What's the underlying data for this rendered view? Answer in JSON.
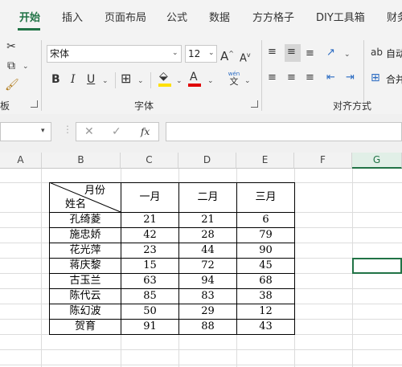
{
  "ribbon_tabs": [
    "开始",
    "插入",
    "页面布局",
    "公式",
    "数据",
    "方方格子",
    "DIY工具箱",
    "财务"
  ],
  "font": {
    "name": "宋体",
    "size": "12",
    "grow": "A",
    "shrink": "A",
    "bold": "B",
    "italic": "I",
    "underline": "U",
    "font_color_letter": "A",
    "phonetic_top": "wén",
    "phonetic_bottom": "文"
  },
  "groups": {
    "clipboard_label": "板",
    "font_label": "字体",
    "alignment_label": "对齐方式"
  },
  "alignment": {
    "wrap_label": "自动",
    "merge_label": "合并"
  },
  "formula_bar": {
    "fx": "fx",
    "cancel": "✕",
    "enter": "✓",
    "value": ""
  },
  "columns": [
    "A",
    "B",
    "C",
    "D",
    "E",
    "F",
    "G"
  ],
  "selected_column": "G",
  "table": {
    "diag_top": "月份",
    "diag_bottom": "姓名",
    "headers": [
      "一月",
      "二月",
      "三月"
    ],
    "rows": [
      {
        "name": "孔绮菱",
        "values": [
          "21",
          "21",
          "6"
        ]
      },
      {
        "name": "施忠娇",
        "values": [
          "42",
          "28",
          "79"
        ]
      },
      {
        "name": "花光萍",
        "values": [
          "23",
          "44",
          "90"
        ]
      },
      {
        "name": "蒋庆黎",
        "values": [
          "15",
          "72",
          "45"
        ]
      },
      {
        "name": "古玉兰",
        "values": [
          "63",
          "94",
          "68"
        ]
      },
      {
        "name": "陈代云",
        "values": [
          "85",
          "83",
          "38"
        ]
      },
      {
        "name": "陈幻波",
        "values": [
          "50",
          "29",
          "12"
        ]
      },
      {
        "name": "贺育",
        "values": [
          "91",
          "88",
          "43"
        ]
      }
    ]
  },
  "colors": {
    "accent": "#217346",
    "ribbon_bg": "#f3f3f3",
    "font_color": "#e00000",
    "highlight": "#ffe000"
  }
}
